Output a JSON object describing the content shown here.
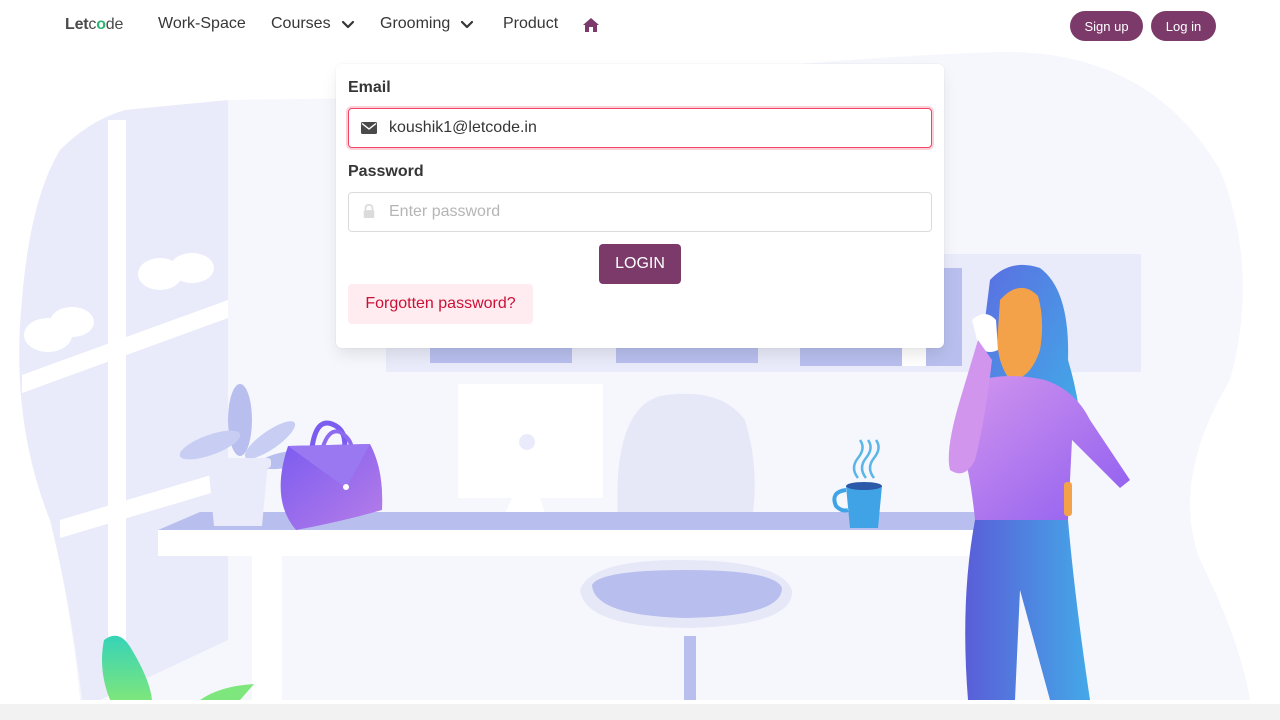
{
  "brand": {
    "logo_prefix": "Let",
    "logo_mid": "c",
    "logo_dot": "o",
    "logo_suffix": "de"
  },
  "nav": {
    "workspace": "Work-Space",
    "courses": "Courses",
    "grooming": "Grooming",
    "product": "Product",
    "home_icon": "home-icon",
    "signup": "Sign up",
    "login": "Log in"
  },
  "login_form": {
    "email_label": "Email",
    "email_value": "koushik1@letcode.in",
    "email_icon": "envelope-icon",
    "password_label": "Password",
    "password_placeholder": "Enter password",
    "password_icon": "lock-icon",
    "submit_label": "LOGIN",
    "forgot_label": "Forgotten password?"
  },
  "colors": {
    "brand": "#7b3a6a",
    "danger_border": "#f14668",
    "forgot_bg": "#feecf0",
    "forgot_text": "#cc0f35"
  }
}
